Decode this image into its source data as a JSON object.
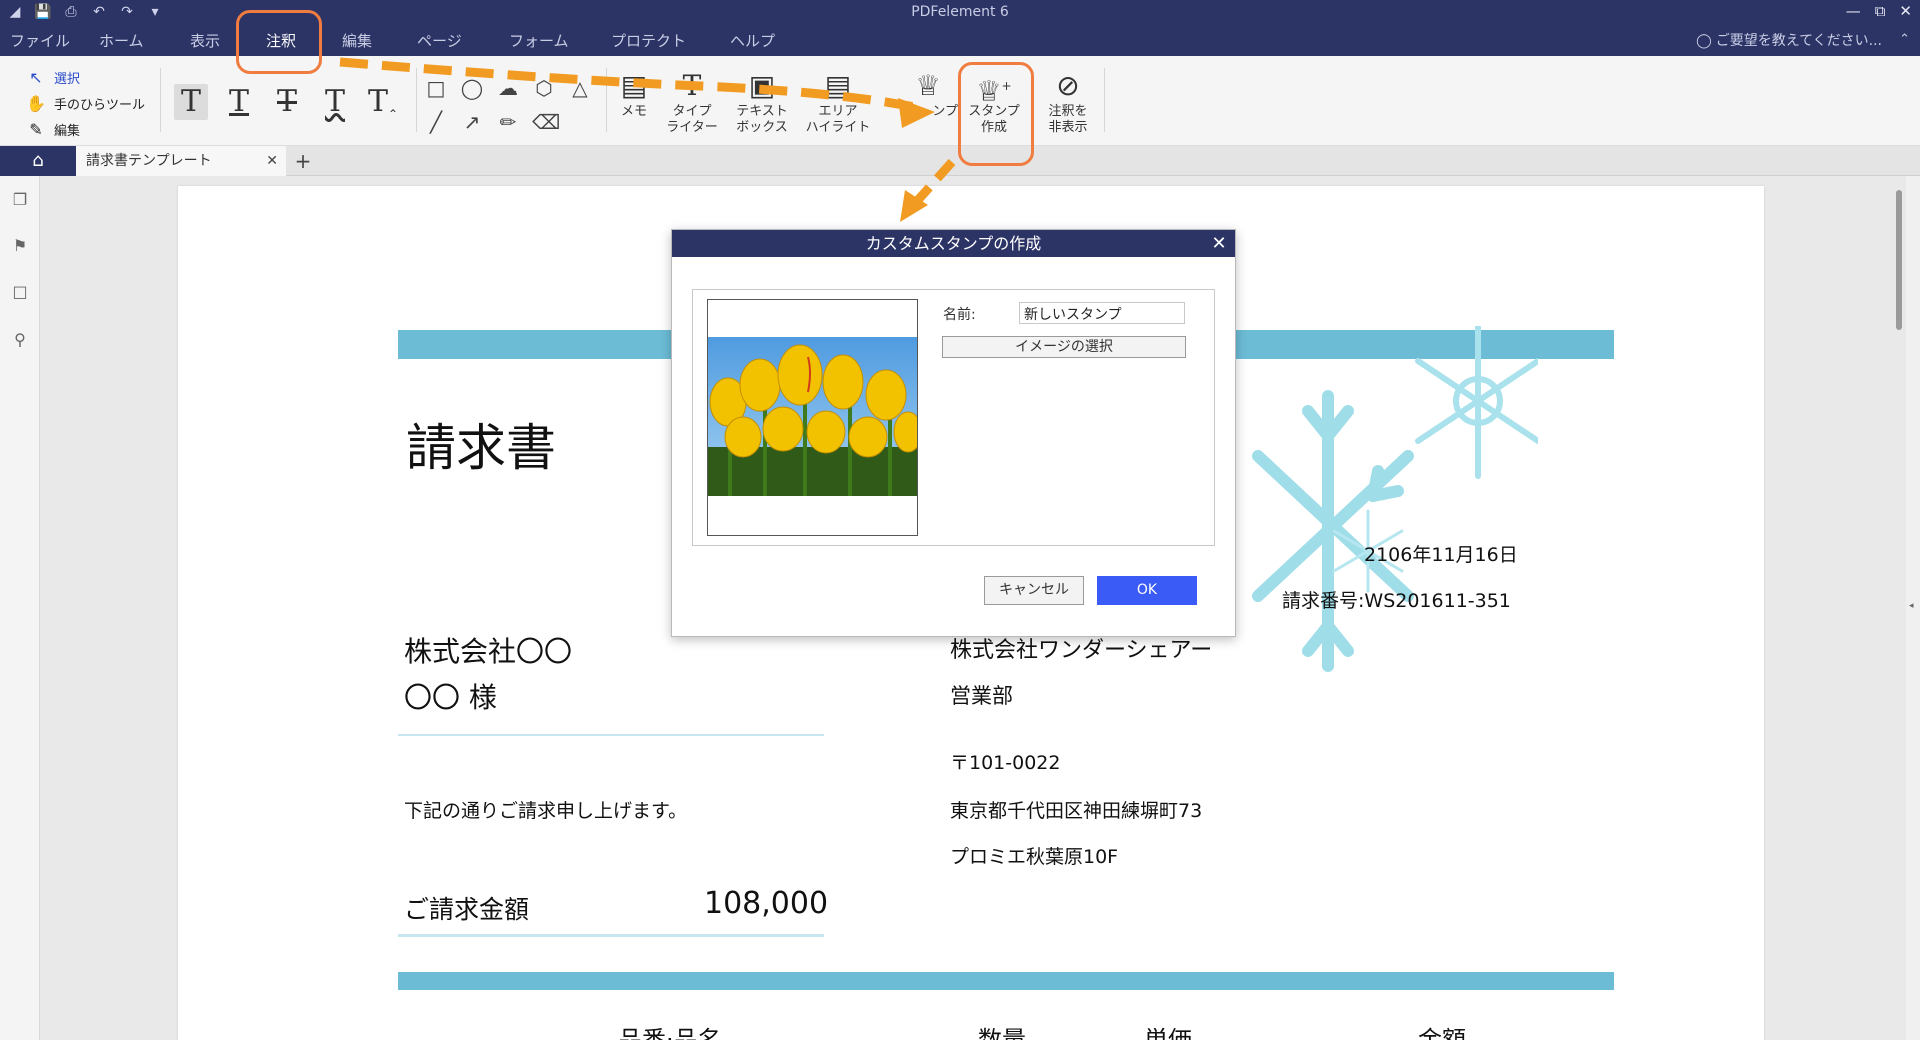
{
  "app": {
    "title": "PDFelement 6",
    "help_hint": "ご要望を教えてください..."
  },
  "menu": {
    "items": [
      "ファイル",
      "ホーム",
      "表示",
      "注釈",
      "編集",
      "ページ",
      "フォーム",
      "プロテクト",
      "ヘルプ"
    ],
    "active": "注釈"
  },
  "ribbon": {
    "select": "選択",
    "hand": "手のひらツール",
    "edit": "編集",
    "memo": "メモ",
    "typewriter": "タイプ\nライター",
    "textbox": "テキスト\nボックス",
    "area_highlight": "エリア\nハイライト",
    "stamp": "スタンプ",
    "stamp_visible": "ンプ",
    "create_stamp": "スタンプ\n作成",
    "hide_annotations": "注釈を\n非表示"
  },
  "tabs": {
    "document": "請求書テンプレート"
  },
  "document": {
    "title": "請求書",
    "date": "2106年11月16日",
    "invoice_no": "請求番号:WS201611-351",
    "client_company": "株式会社〇〇",
    "client_person": "〇〇 様",
    "message": "下記の通りご請求申し上げます。",
    "amount_label": "ご請求金額",
    "amount_value": "108,000",
    "sender_company": "株式会社ワンダーシェアー",
    "sender_dept": "営業部",
    "sender_zip": "〒101-0022",
    "sender_address1": "東京都千代田区神田練塀町73",
    "sender_address2": "プロミエ秋葉原10F",
    "table_headers": [
      "品番·品名",
      "数量",
      "単価",
      "金額"
    ]
  },
  "dialog": {
    "title": "カスタムスタンプの作成",
    "name_label": "名前:",
    "name_value": "新しいスタンプ",
    "select_image": "イメージの選択",
    "cancel": "キャンセル",
    "ok": "OK"
  },
  "colors": {
    "titlebar": "#2c3466",
    "accent_band": "#6cbcd6",
    "annotation_orange": "#f29b22",
    "highlight_box": "#f07c41",
    "ok_button": "#3b5bf6",
    "snowflake": "#9fdde8"
  },
  "icons": [
    "select-arrow-icon",
    "hand-icon",
    "edit-icon",
    "text-icon",
    "rectangle-icon",
    "ellipse-icon",
    "cloud-icon",
    "polygon-icon",
    "line-icon",
    "arrow-icon",
    "pencil-icon",
    "eraser-icon",
    "memo-icon",
    "typewriter-icon",
    "textbox-icon",
    "area-highlight-icon",
    "stamp-icon",
    "create-stamp-icon",
    "hide-annotations-icon",
    "home-icon",
    "thumbnail-icon",
    "bookmark-icon",
    "comment-icon",
    "search-icon"
  ]
}
